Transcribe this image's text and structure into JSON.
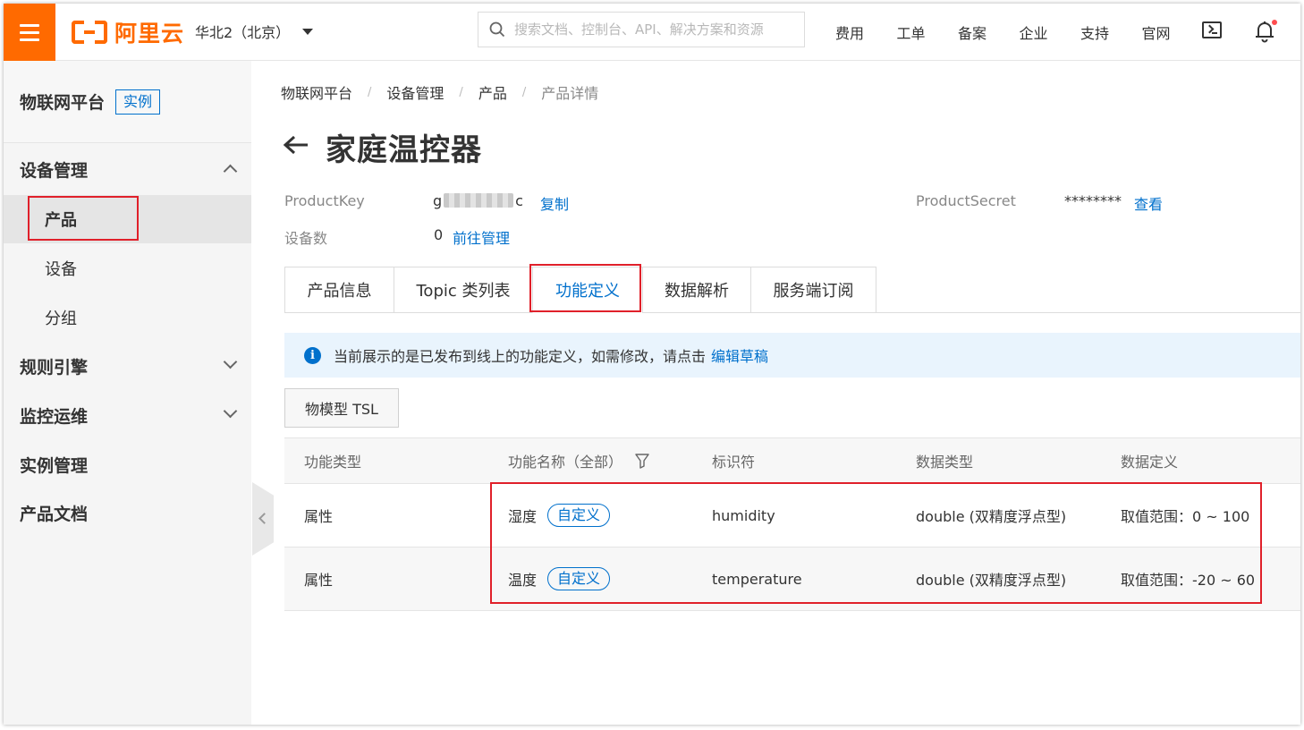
{
  "header": {
    "logo_text": "阿里云",
    "region": "华北2（北京）",
    "search_placeholder": "搜索文档、控制台、API、解决方案和资源",
    "nav": [
      "费用",
      "工单",
      "备案",
      "企业",
      "支持",
      "官网"
    ],
    "accent_color": "#ff6a00"
  },
  "sidebar": {
    "title": "物联网平台",
    "badge": "实例",
    "groups": [
      {
        "label": "设备管理",
        "expanded": true,
        "items": [
          "产品",
          "设备",
          "分组"
        ],
        "active_item": "产品"
      },
      {
        "label": "规则引擎",
        "expanded": false
      },
      {
        "label": "监控运维",
        "expanded": false
      },
      {
        "label": "实例管理"
      },
      {
        "label": "产品文档"
      }
    ]
  },
  "breadcrumb": [
    "物联网平台",
    "设备管理",
    "产品",
    "产品详情"
  ],
  "product": {
    "name": "家庭温控器",
    "product_key_label": "ProductKey",
    "product_key_start": "g",
    "product_key_end": "c",
    "copy_link": "复制",
    "product_secret_label": "ProductSecret",
    "product_secret_value": "********",
    "view_link": "查看",
    "device_count_label": "设备数",
    "device_count": "0",
    "manage_link": "前往管理"
  },
  "tabs": [
    {
      "label": "产品信息",
      "active": false
    },
    {
      "label": "Topic 类列表",
      "active": false
    },
    {
      "label": "功能定义",
      "active": true
    },
    {
      "label": "数据解析",
      "active": false
    },
    {
      "label": "服务端订阅",
      "active": false
    }
  ],
  "notice": {
    "text": "当前展示的是已发布到线上的功能定义，如需修改，请点击",
    "link": "编辑草稿"
  },
  "tsl_button": "物模型 TSL",
  "table": {
    "columns": [
      "功能类型",
      "功能名称（全部）",
      "标识符",
      "数据类型",
      "数据定义"
    ],
    "rows": [
      {
        "type": "属性",
        "name": "湿度",
        "tag": "自定义",
        "identifier": "humidity",
        "data_type": "double (双精度浮点型)",
        "definition": "取值范围：0 ~ 100"
      },
      {
        "type": "属性",
        "name": "温度",
        "tag": "自定义",
        "identifier": "temperature",
        "data_type": "double (双精度浮点型)",
        "definition": "取值范围：-20 ~ 60"
      }
    ]
  },
  "colors": {
    "link": "#0070cc",
    "highlight": "#e0202a"
  }
}
